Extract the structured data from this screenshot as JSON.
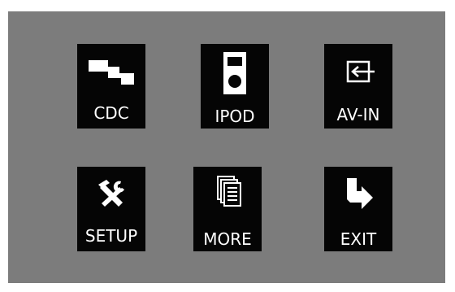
{
  "menu": {
    "items": [
      {
        "id": "cdc",
        "label": "CDC",
        "icon": "cd-changer-stairs-icon"
      },
      {
        "id": "ipod",
        "label": "IPOD",
        "icon": "ipod-icon"
      },
      {
        "id": "avin",
        "label": "AV-IN",
        "icon": "av-input-icon"
      },
      {
        "id": "setup",
        "label": "SETUP",
        "icon": "tools-icon"
      },
      {
        "id": "more",
        "label": "MORE",
        "icon": "pages-icon"
      },
      {
        "id": "exit",
        "label": "EXIT",
        "icon": "exit-arrow-icon"
      }
    ]
  },
  "colors": {
    "background": "#7c7c7c",
    "tile": "#050505",
    "foreground": "#ffffff"
  }
}
